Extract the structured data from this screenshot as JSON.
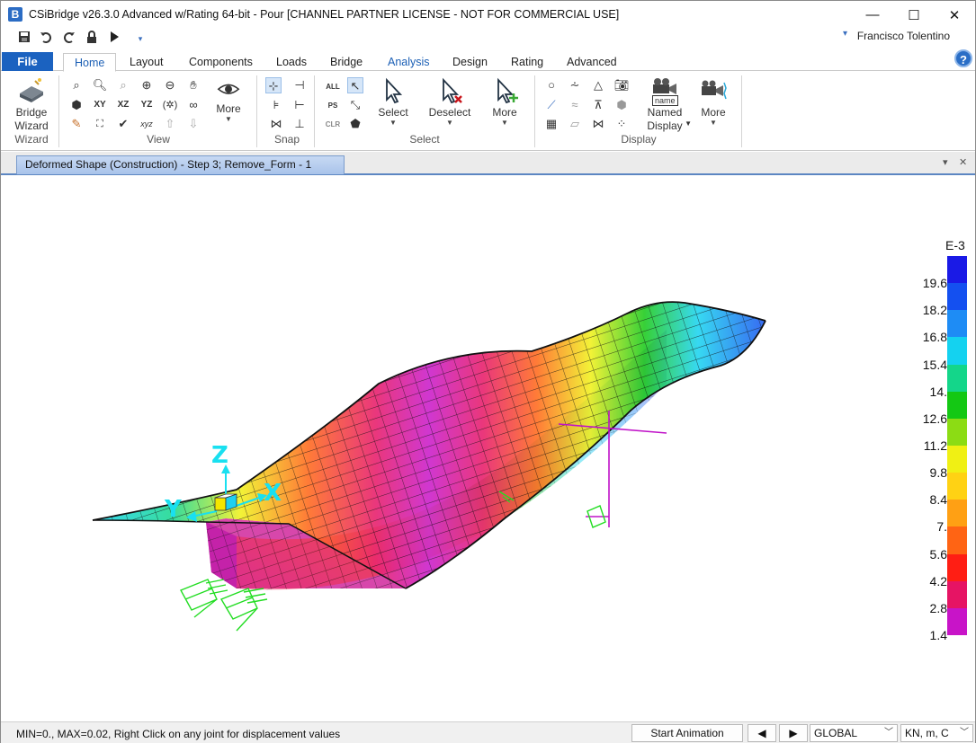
{
  "window": {
    "app_icon": "B",
    "title": "CSiBridge v26.3.0 Advanced w/Rating 64-bit - Pour  [CHANNEL PARTNER LICENSE - NOT FOR COMMERCIAL USE]",
    "minimize": "—",
    "maximize": "☐",
    "close": "✕"
  },
  "quick_access": {
    "icons": [
      "save-icon",
      "undo-icon",
      "redo-icon",
      "lock-icon",
      "run-icon",
      "customize-dropdown-icon"
    ],
    "user_name": "Francisco Tolentino"
  },
  "ribbon_tabs": {
    "file": "File",
    "items": [
      "Home",
      "Layout",
      "Components",
      "Loads",
      "Bridge",
      "Analysis",
      "Design",
      "Rating",
      "Advanced"
    ],
    "active": "Home",
    "help": "?"
  },
  "ribbon": {
    "bridge_wizard": {
      "line1": "Bridge",
      "line2": "Wizard",
      "group": "Wizard"
    },
    "view": {
      "group": "View",
      "xy": "XY",
      "xz": "XZ",
      "yz": "YZ",
      "xyz": "xyz",
      "more": "More"
    },
    "snap": {
      "group": "Snap"
    },
    "select": {
      "group": "Select",
      "all": "ALL",
      "ps": "PS",
      "clr": "CLR",
      "select_label": "Select",
      "deselect_label": "Deselect",
      "more": "More"
    },
    "display": {
      "group": "Display",
      "named_tag": "name",
      "named_line1": "Named",
      "named_line2": "Display",
      "more": "More"
    }
  },
  "document": {
    "tab_title": "Deformed Shape (Construction) - Step 3; Remove_Form - 1",
    "dropdown": "▾",
    "close": "✕"
  },
  "view3d": {
    "axis_z": "Z",
    "axis_x": "X",
    "axis_y": "Y"
  },
  "legend": {
    "unit_label": "E-3",
    "labels": [
      "19.6",
      "18.2",
      "16.8",
      "15.4",
      "14.",
      "12.6",
      "11.2",
      "9.8",
      "8.4",
      "7.",
      "5.6",
      "4.2",
      "2.8",
      "1.4"
    ],
    "colors": [
      "#1a1ae6",
      "#1450f0",
      "#1e8cf5",
      "#14d2f0",
      "#14d68a",
      "#14c814",
      "#8cdc14",
      "#f0f014",
      "#ffd214",
      "#ffa014",
      "#ff6414",
      "#ff1e14",
      "#e61464",
      "#c814c8"
    ]
  },
  "status_bar": {
    "message": "MIN=0., MAX=0.02, Right Click on any joint for displacement values",
    "start_animation": "Start Animation",
    "prev": "◀",
    "next": "▶",
    "coord_system": "GLOBAL",
    "units": "KN, m, C"
  }
}
